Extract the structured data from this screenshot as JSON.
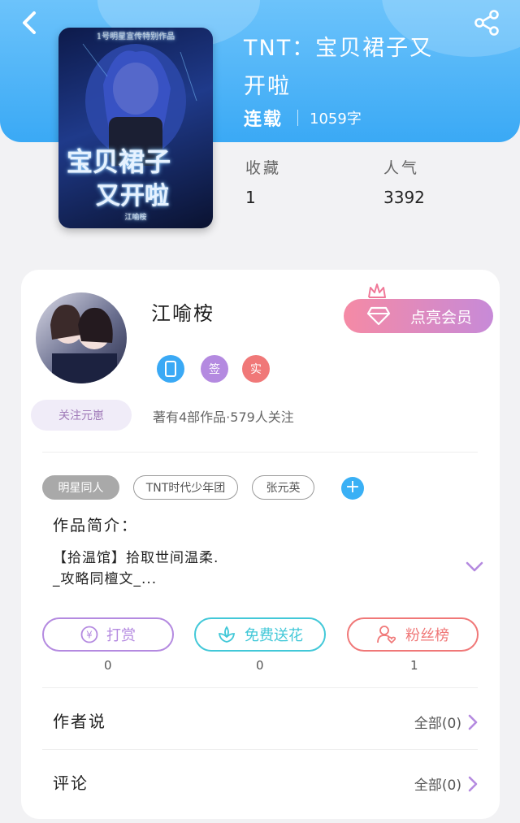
{
  "header": {
    "book_title_line1": "TNT：宝贝裙子又",
    "book_title_line2": "开啦",
    "serial_status": "连载",
    "word_count": "1059字",
    "stats": [
      {
        "label": "收藏",
        "value": "1"
      },
      {
        "label": "人气",
        "value": "3392"
      }
    ]
  },
  "cover": {
    "top_text": "1号明星宣传特别作品",
    "big_line1": "宝贝裙子",
    "big_line2": "又开啦",
    "small_text": "江喻桉"
  },
  "author": {
    "name": "江喻桉",
    "follow_label": "关注元崽",
    "vip_label": "点亮会员",
    "badges": [
      {
        "icon": "phone-icon",
        "text": "",
        "color": "#3aa9f5"
      },
      {
        "icon": "sign-icon",
        "text": "签",
        "color": "#b48ae0"
      },
      {
        "icon": "verified-icon",
        "text": "实",
        "color": "#f07878"
      }
    ],
    "stats_text": "著有4部作品·579人关注"
  },
  "tags": [
    "明星同人",
    "TNT时代少年团",
    "张元英"
  ],
  "intro": {
    "label": "作品简介：",
    "line1": "【拾温馆】拾取世间温柔.",
    "line2": "_攻略同檀文_..."
  },
  "actions": [
    {
      "label": "打赏",
      "count": "0",
      "icon": "yen-icon",
      "color": "#b48ae0"
    },
    {
      "label": "免费送花",
      "count": "0",
      "icon": "flower-icon",
      "color": "#42c8d8"
    },
    {
      "label": "粉丝榜",
      "count": "1",
      "icon": "fan-icon",
      "color": "#f07878"
    }
  ],
  "sections": [
    {
      "label": "作者说",
      "right": "全部(0)"
    },
    {
      "label": "评论",
      "right": "全部(0)"
    }
  ],
  "colors": {
    "header_blue": "#3aa9f5",
    "accent_purple": "#b48ae0",
    "accent_pink": "#f07878"
  }
}
